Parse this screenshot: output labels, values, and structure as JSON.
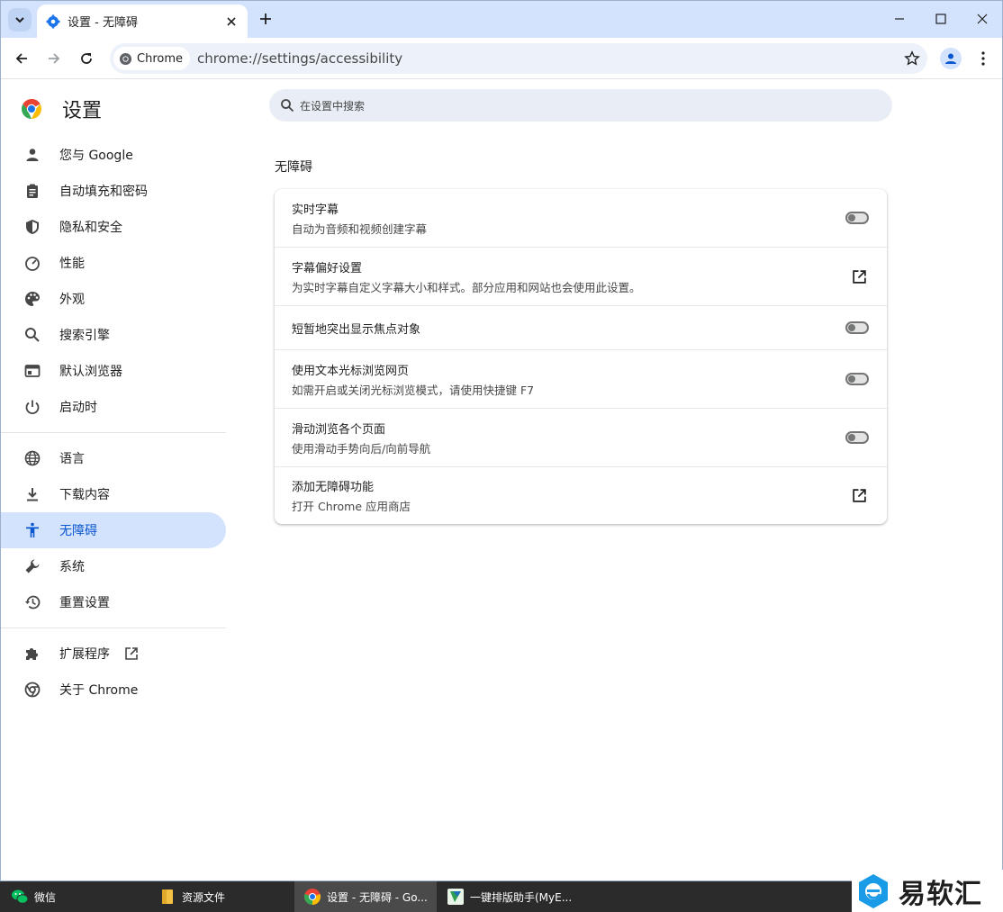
{
  "browser": {
    "tab_title": "设置 - 无障碍",
    "omnibox_chip": "Chrome",
    "url": "chrome://settings/accessibility"
  },
  "sidebar": {
    "title": "设置",
    "items": [
      {
        "label": "您与 Google",
        "icon": "person-icon"
      },
      {
        "label": "自动填充和密码",
        "icon": "clipboard-icon"
      },
      {
        "label": "隐私和安全",
        "icon": "shield-icon"
      },
      {
        "label": "性能",
        "icon": "speedometer-icon"
      },
      {
        "label": "外观",
        "icon": "palette-icon"
      },
      {
        "label": "搜索引擎",
        "icon": "search-icon"
      },
      {
        "label": "默认浏览器",
        "icon": "browser-icon"
      },
      {
        "label": "启动时",
        "icon": "power-icon"
      },
      {
        "label": "语言",
        "icon": "globe-icon"
      },
      {
        "label": "下载内容",
        "icon": "download-icon"
      },
      {
        "label": "无障碍",
        "icon": "accessibility-icon",
        "active": true
      },
      {
        "label": "系统",
        "icon": "wrench-icon"
      },
      {
        "label": "重置设置",
        "icon": "history-icon"
      },
      {
        "label": "扩展程序",
        "icon": "puzzle-icon"
      },
      {
        "label": "关于 Chrome",
        "icon": "chrome-icon"
      }
    ]
  },
  "search": {
    "placeholder": "在设置中搜索"
  },
  "section_title": "无障碍",
  "settings": [
    {
      "label": "实时字幕",
      "sub": "自动为音频和视频创建字幕",
      "control": "toggle",
      "on": false
    },
    {
      "label": "字幕偏好设置",
      "sub": "为实时字幕自定义字幕大小和样式。部分应用和网站也会使用此设置。",
      "control": "launch"
    },
    {
      "label": "短暂地突出显示焦点对象",
      "sub": "",
      "control": "toggle",
      "on": false
    },
    {
      "label": "使用文本光标浏览网页",
      "sub": "如需开启或关闭光标浏览模式，请使用快捷键 F7",
      "control": "toggle",
      "on": false
    },
    {
      "label": "滑动浏览各个页面",
      "sub": "使用滑动手势向后/向前导航",
      "control": "toggle",
      "on": false
    },
    {
      "label": "添加无障碍功能",
      "sub": "打开 Chrome 应用商店",
      "control": "launch"
    }
  ],
  "taskbar": [
    {
      "label": "微信",
      "icon": "wechat-icon"
    },
    {
      "label": "资源文件",
      "icon": "folder-icon"
    },
    {
      "label": "设置 - 无障碍 - Go...",
      "icon": "chrome-icon",
      "active": true
    },
    {
      "label": "一键排版助手(MyE...",
      "icon": "app-icon"
    }
  ],
  "watermark": {
    "text": "易软汇"
  },
  "colors": {
    "accent": "#0b57d0",
    "active_bg": "#d3e3fd",
    "tabstrip": "#d3e3fd"
  }
}
